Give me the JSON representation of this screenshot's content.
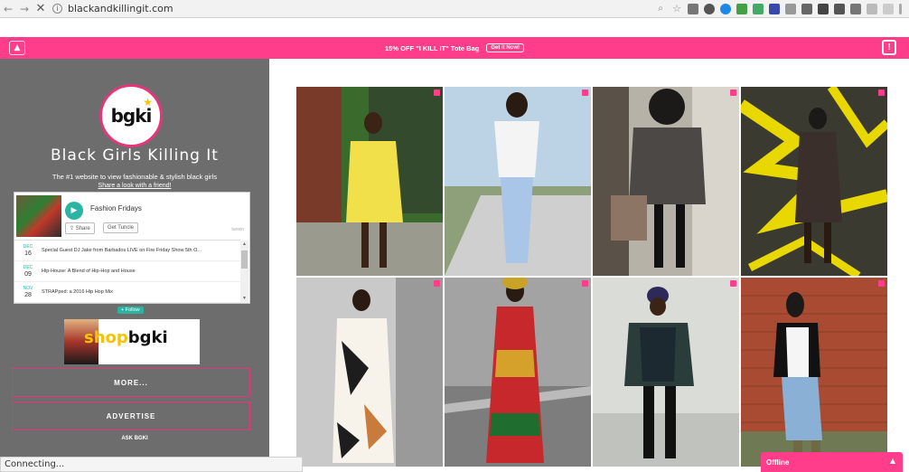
{
  "browser": {
    "url": "blackandkillingit.com",
    "back_icon": "back-arrow-icon",
    "forward_icon": "forward-arrow-icon",
    "stop_icon": "close-icon"
  },
  "promo": {
    "text": "15% OFF \"I KILL IT\" Tote Bag",
    "button": "Get it Now!"
  },
  "sidebar": {
    "logo": "bgki",
    "title": "Black Girls Killing It",
    "tagline": "The #1 website to view fashionable & stylish black girls",
    "share_link": "Share a look with a friend!",
    "widget": {
      "title": "Fashion Fridays",
      "share_label": "Share",
      "tuneup_label": "Get Tuncle",
      "brand": "tunein",
      "items": [
        {
          "month": "DEC",
          "day": "16",
          "text": "Special Guest DJ Jake from Barbados LIVE on Fire Friday Show 5th O..."
        },
        {
          "month": "DEC",
          "day": "09",
          "text": "Hip-House: A Blend of Hip-Hop and House"
        },
        {
          "month": "NOV",
          "day": "28",
          "text": "STRAPped: a 2016 Hip Hop Mix"
        }
      ],
      "follow_label": "Follow"
    },
    "shop_prefix": "shop",
    "shop_brand": "bgki",
    "more_button": "MORE...",
    "advertise_button": "ADVERTISE",
    "footer": "ASK BGKI"
  },
  "grid": {
    "tiles": [
      {
        "alt": "woman in yellow dress",
        "bg": "#3a6b2c",
        "accent": "#f2e04b"
      },
      {
        "alt": "woman in white tee and jeans",
        "bg": "#8fb2d0",
        "accent": "#f4f4f4"
      },
      {
        "alt": "woman in fur coat",
        "bg": "#b7b2a8",
        "accent": "#3b3835"
      },
      {
        "alt": "woman against yellow graffiti",
        "bg": "#2f2f2f",
        "accent": "#e9d800"
      },
      {
        "alt": "woman in geometric dress",
        "bg": "#c9c9c9",
        "accent": "#f7f3ea"
      },
      {
        "alt": "woman in african print gown",
        "bg": "#9a9a9a",
        "accent": "#c7282c"
      },
      {
        "alt": "woman in green bomber jacket",
        "bg": "#dadcd8",
        "accent": "#2a3d3a"
      },
      {
        "alt": "woman in leather jacket",
        "bg": "#a84b32",
        "accent": "#f5f5f5"
      }
    ]
  },
  "status": "Connecting...",
  "chat": {
    "label": "Offline"
  }
}
